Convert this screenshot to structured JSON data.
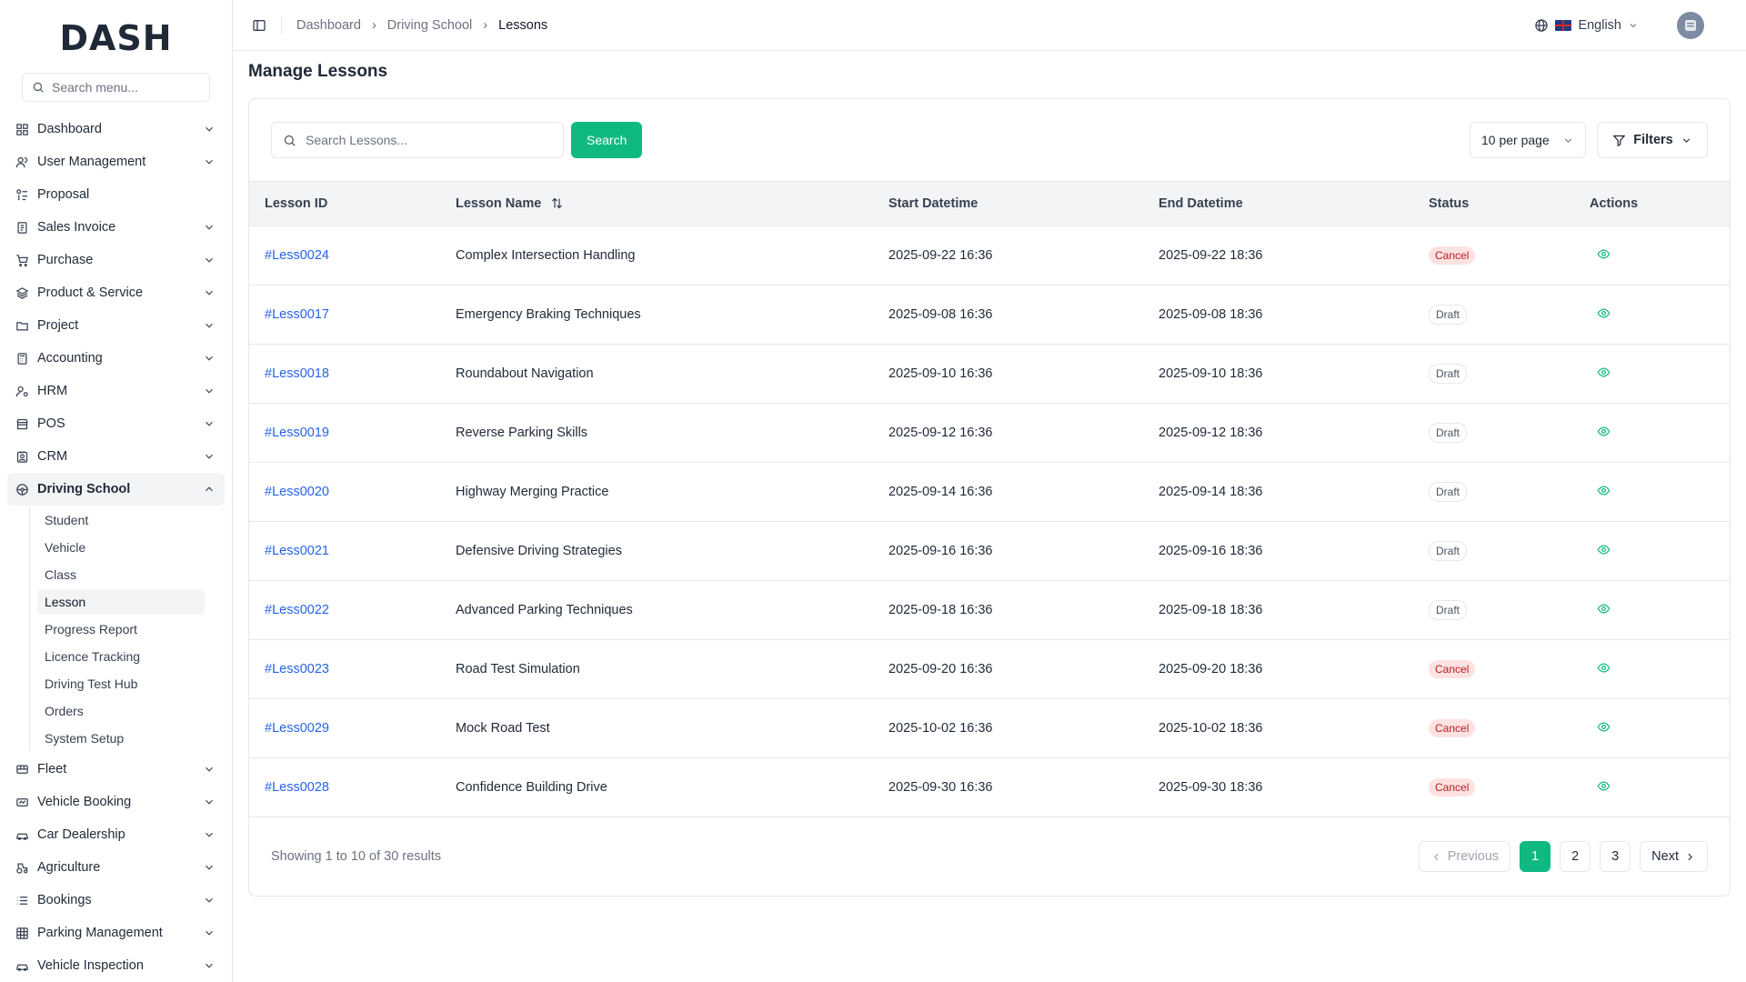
{
  "brand": {
    "logo_text": "DASH",
    "accent": "#10b981"
  },
  "sidebar": {
    "search_placeholder": "Search menu...",
    "items": [
      {
        "label": "Dashboard",
        "icon": "grid-icon",
        "chevron": true
      },
      {
        "label": "User Management",
        "icon": "users-icon",
        "chevron": true
      },
      {
        "label": "Proposal",
        "icon": "proposal-icon",
        "chevron": false
      },
      {
        "label": "Sales Invoice",
        "icon": "invoice-icon",
        "chevron": true
      },
      {
        "label": "Purchase",
        "icon": "cart-icon",
        "chevron": true
      },
      {
        "label": "Product & Service",
        "icon": "layers-icon",
        "chevron": true
      },
      {
        "label": "Project",
        "icon": "folder-icon",
        "chevron": true
      },
      {
        "label": "Accounting",
        "icon": "calculator-icon",
        "chevron": true
      },
      {
        "label": "HRM",
        "icon": "user-cog-icon",
        "chevron": true
      },
      {
        "label": "POS",
        "icon": "store-icon",
        "chevron": true
      },
      {
        "label": "CRM",
        "icon": "contact-icon",
        "chevron": true
      },
      {
        "label": "Driving School",
        "icon": "steering-wheel-icon",
        "chevron": true,
        "active": true
      }
    ],
    "driving_school_sub": [
      {
        "label": "Student"
      },
      {
        "label": "Vehicle"
      },
      {
        "label": "Class"
      },
      {
        "label": "Lesson",
        "active": true
      },
      {
        "label": "Progress Report"
      },
      {
        "label": "Licence Tracking"
      },
      {
        "label": "Driving Test Hub"
      },
      {
        "label": "Orders"
      },
      {
        "label": "System Setup"
      }
    ],
    "items_after": [
      {
        "label": "Fleet",
        "icon": "bus-icon"
      },
      {
        "label": "Vehicle Booking",
        "icon": "ticket-icon"
      },
      {
        "label": "Car Dealership",
        "icon": "car-icon"
      },
      {
        "label": "Agriculture",
        "icon": "tractor-icon"
      },
      {
        "label": "Bookings",
        "icon": "list-icon"
      },
      {
        "label": "Parking Management",
        "icon": "parking-grid-icon"
      },
      {
        "label": "Vehicle Inspection",
        "icon": "car-check-icon"
      }
    ]
  },
  "topbar": {
    "breadcrumbs": [
      "Dashboard",
      "Driving School",
      "Lessons"
    ],
    "language": "English"
  },
  "main": {
    "title": "Manage Lessons",
    "search_placeholder": "Search Lessons...",
    "search_button": "Search",
    "per_page": "10 per page",
    "filters_button": "Filters",
    "columns": [
      "Lesson ID",
      "Lesson Name",
      "Start Datetime",
      "End Datetime",
      "Status",
      "Actions"
    ],
    "rows": [
      {
        "id": "#Less0024",
        "name": "Complex Intersection Handling",
        "start": "2025-09-22 16:36",
        "end": "2025-09-22 18:36",
        "status": "Cancel"
      },
      {
        "id": "#Less0017",
        "name": "Emergency Braking Techniques",
        "start": "2025-09-08 16:36",
        "end": "2025-09-08 18:36",
        "status": "Draft"
      },
      {
        "id": "#Less0018",
        "name": "Roundabout Navigation",
        "start": "2025-09-10 16:36",
        "end": "2025-09-10 18:36",
        "status": "Draft"
      },
      {
        "id": "#Less0019",
        "name": "Reverse Parking Skills",
        "start": "2025-09-12 16:36",
        "end": "2025-09-12 18:36",
        "status": "Draft"
      },
      {
        "id": "#Less0020",
        "name": "Highway Merging Practice",
        "start": "2025-09-14 16:36",
        "end": "2025-09-14 18:36",
        "status": "Draft"
      },
      {
        "id": "#Less0021",
        "name": "Defensive Driving Strategies",
        "start": "2025-09-16 16:36",
        "end": "2025-09-16 18:36",
        "status": "Draft"
      },
      {
        "id": "#Less0022",
        "name": "Advanced Parking Techniques",
        "start": "2025-09-18 16:36",
        "end": "2025-09-18 18:36",
        "status": "Draft"
      },
      {
        "id": "#Less0023",
        "name": "Road Test Simulation",
        "start": "2025-09-20 16:36",
        "end": "2025-09-20 18:36",
        "status": "Cancel"
      },
      {
        "id": "#Less0029",
        "name": "Mock Road Test",
        "start": "2025-10-02 16:36",
        "end": "2025-10-02 18:36",
        "status": "Cancel"
      },
      {
        "id": "#Less0028",
        "name": "Confidence Building Drive",
        "start": "2025-09-30 16:36",
        "end": "2025-09-30 18:36",
        "status": "Cancel"
      }
    ],
    "results_text": "Showing 1 to 10 of 30 results",
    "pagination": {
      "previous": "Previous",
      "next": "Next",
      "pages": [
        "1",
        "2",
        "3"
      ],
      "current": "1"
    }
  }
}
